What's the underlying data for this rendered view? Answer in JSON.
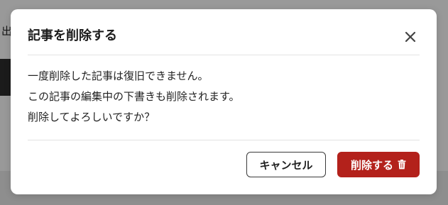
{
  "background": {
    "partial_text": "出"
  },
  "dialog": {
    "title": "記事を削除する",
    "close_icon": "close-icon",
    "message_lines": [
      "一度削除した記事は復旧できません。",
      "この記事の編集中の下書きも削除されます。",
      "削除してよろしいですか？"
    ],
    "cancel_label": "キャンセル",
    "delete_label": "削除する",
    "delete_icon": "trash-icon"
  },
  "colors": {
    "danger": "#b3211b",
    "overlay": "rgba(0,0,0,0.34)"
  }
}
